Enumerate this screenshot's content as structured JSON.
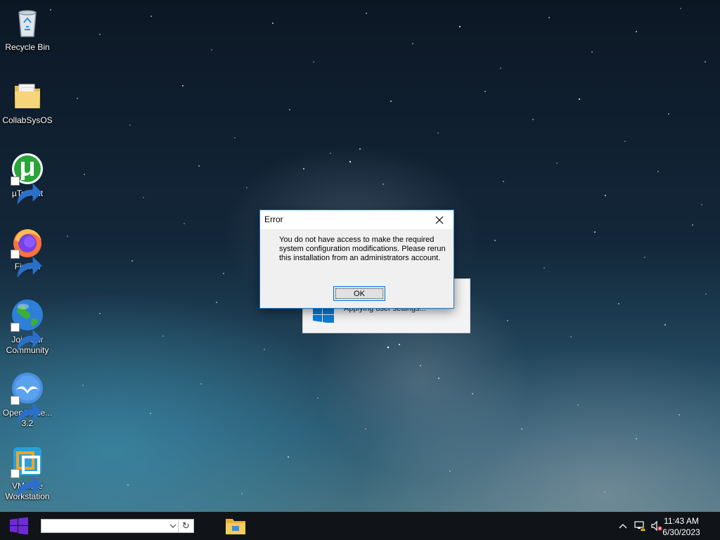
{
  "desktop": {
    "icons": [
      {
        "label": "Recycle Bin",
        "icon": "recycle-bin-icon",
        "shortcut": false
      },
      {
        "label": "CollabSysOS",
        "icon": "folder-icon",
        "shortcut": false
      },
      {
        "label": "µTorrent",
        "icon": "utorrent-icon",
        "shortcut": true
      },
      {
        "label": "Firefox",
        "icon": "firefox-icon",
        "shortcut": true
      },
      {
        "label": "Join Our Community",
        "icon": "globe-icon",
        "shortcut": true
      },
      {
        "label": "OpenOffice... 3.2",
        "icon": "openoffice-icon",
        "shortcut": true
      },
      {
        "label": "VMware Workstation",
        "icon": "vmware-icon",
        "shortcut": true
      }
    ]
  },
  "background_window": {
    "status_text": "Applying user settings..."
  },
  "error_dialog": {
    "title": "Error",
    "message": "You do not have access to make the required system configuration modifications. Please rerun this installation from an administrators account.",
    "ok_label": "OK",
    "close_symbol": "✕",
    "border_color": "#1979ca"
  },
  "taskbar": {
    "search_value": "",
    "refresh_symbol": "↻",
    "time": "11:43 AM",
    "date": "6/30/2023",
    "start_color": "#6f2bd3"
  }
}
